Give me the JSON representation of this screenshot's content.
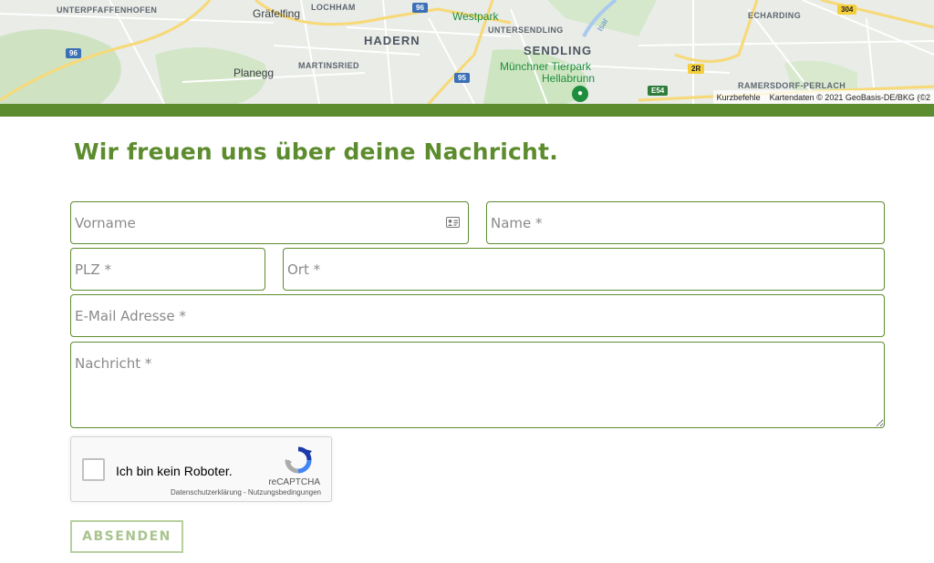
{
  "map": {
    "labels": {
      "unterpfaffenhofen": "UNTERPFAFFENHOFEN",
      "graefelfing": "Gräfelfing",
      "lochham": "LOCHHAM",
      "westpark": "Westpark",
      "untersendling": "UNTERSENDLING",
      "hadern": "HADERN",
      "sendling": "SENDLING",
      "tierpark": "Münchner Tierpark",
      "hellabrunn": "Hellabrunn",
      "martinsried": "MARTINSRIED",
      "planegg": "Planegg",
      "echarding": "ECHARDING",
      "ramersdorf": "RAMERSDORF-PERLACH",
      "isar": "Isar"
    },
    "shields": {
      "a96_left": "96",
      "a96_top": "96",
      "a95": "95",
      "r2": "2R",
      "e54": "E54",
      "b304": "304"
    },
    "icons": {
      "zoo": "paw-icon"
    },
    "attribution": {
      "shortcuts": "Kurzbefehle",
      "data": "Kartendaten © 2021 GeoBasis-DE/BKG (©2"
    }
  },
  "form": {
    "heading": "Wir freuen uns über deine Nachricht.",
    "fields": {
      "vorname": {
        "placeholder": "Vorname",
        "value": ""
      },
      "name": {
        "placeholder": "Name *",
        "value": ""
      },
      "plz": {
        "placeholder": "PLZ *",
        "value": ""
      },
      "ort": {
        "placeholder": "Ort *",
        "value": ""
      },
      "email": {
        "placeholder": "E-Mail Adresse *",
        "value": ""
      },
      "nachricht": {
        "placeholder": "Nachricht *",
        "value": ""
      }
    },
    "recaptcha": {
      "label": "Ich bin kein Roboter.",
      "brand": "reCAPTCHA",
      "privacy": "Datenschutzerklärung",
      "separator": " - ",
      "terms": "Nutzungsbedingungen",
      "checked": false
    },
    "submit_label": "ABSENDEN"
  },
  "colors": {
    "accent_green": "#5d8c2e",
    "submit_text": "#a9c48e",
    "map_background": "#e9ece7"
  }
}
